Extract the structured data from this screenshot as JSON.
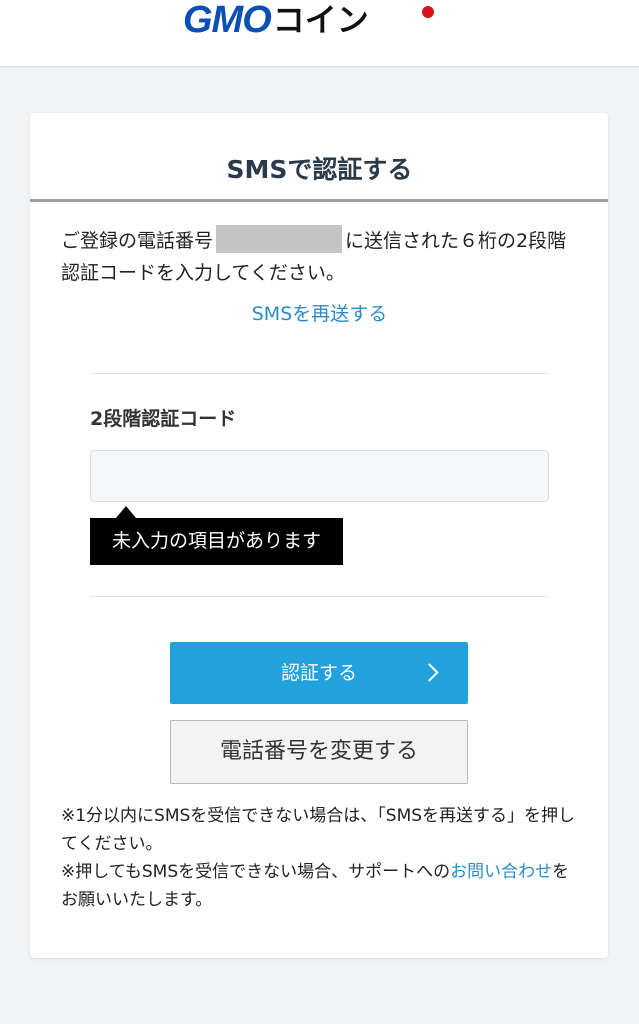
{
  "header": {
    "logo_gmo": "GMO",
    "logo_coin": "コイン"
  },
  "card": {
    "title": "SMSで認証する",
    "intro_prefix": "ご登録の電話番号",
    "intro_suffix": "に送信された６桁の2段階認証コードを入力してください。",
    "resend_link": "SMSを再送する"
  },
  "form": {
    "code_label": "2段階認証コード",
    "code_value": "",
    "tooltip": "未入力の項目があります"
  },
  "actions": {
    "submit_label": "認証する",
    "change_phone_label": "電話番号を変更する"
  },
  "notes": {
    "line1": "※1分以内にSMSを受信できない場合は、「SMSを再送する」を押してください。",
    "line2_prefix": "※押してもSMSを受信できない場合、サポートへの",
    "line2_link": "お問い合わせ",
    "line2_suffix": "をお願いいたします。"
  },
  "colors": {
    "accent": "#22a2dd",
    "link": "#2b8dc7",
    "brand_blue": "#0a4fb4",
    "brand_red": "#d7151a"
  },
  "icons": {
    "submit_arrow": "chevron-right-icon"
  }
}
